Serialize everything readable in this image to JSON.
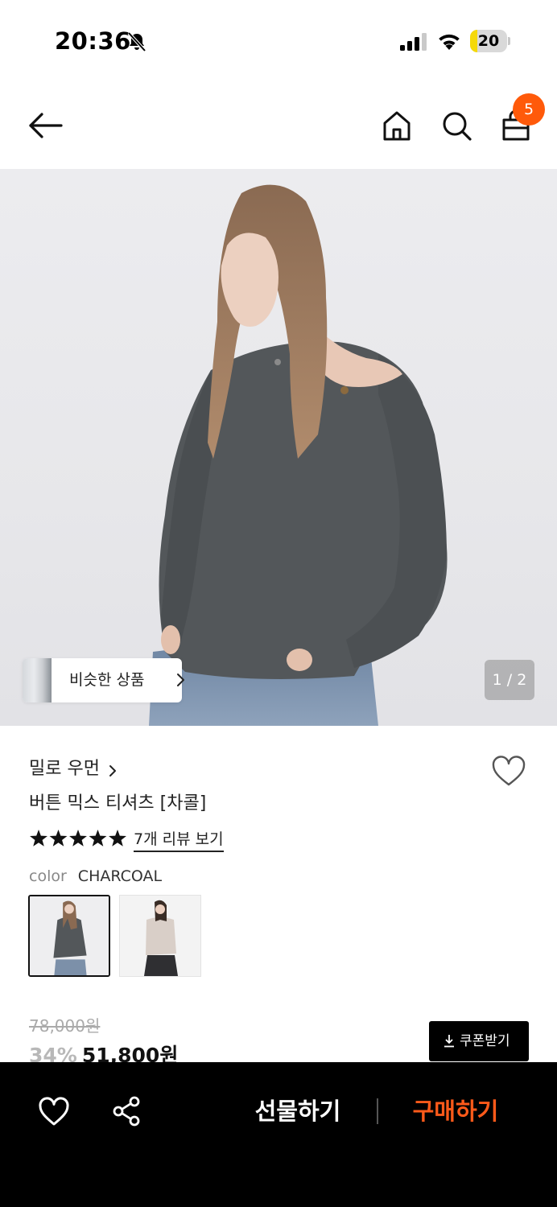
{
  "status_bar": {
    "time": "20:36",
    "battery": "20",
    "battery_level": 0.2,
    "icons": [
      "bell-slash-icon",
      "cellular-signal-icon",
      "wifi-icon",
      "battery-icon"
    ]
  },
  "nav": {
    "icons": [
      "arrow-left-icon",
      "home-icon",
      "search-icon",
      "shopping-bag-icon"
    ],
    "cart_count": "5"
  },
  "hero": {
    "similar_products_label": "비슷한 상품",
    "page_indicator": "1 / 2"
  },
  "product": {
    "brand": "밀로 우먼",
    "name": "버튼 믹스 티셔츠 [차콜]",
    "rating_stars": 5,
    "review_link": "7개 리뷰 보기",
    "color_label": "color",
    "color_value": "CHARCOAL",
    "swatches": [
      "charcoal",
      "beige"
    ],
    "original_price": "78,000원",
    "discount": "34%",
    "sale_price": "51,800원",
    "coupon_label": "쿠폰받기"
  },
  "bottom_bar": {
    "gift_label": "선물하기",
    "buy_label": "구매하기"
  },
  "colors": {
    "accent": "#ff5a0a",
    "buy_text": "#ff5a1a",
    "bottom_bar_bg": "#000000",
    "garment": "#53575a"
  }
}
